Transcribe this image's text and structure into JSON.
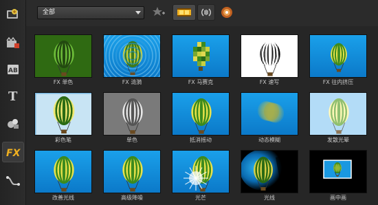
{
  "toolbar": {
    "category_dropdown": {
      "selected": "全部"
    },
    "icons": [
      "add-to-favorites-icon",
      "video-filter-icon",
      "audio-filter-icon",
      "browse-icon"
    ]
  },
  "sidebar": {
    "items": [
      {
        "name": "media-icon"
      },
      {
        "name": "instant-project-icon"
      },
      {
        "name": "transition-icon"
      },
      {
        "name": "title-icon"
      },
      {
        "name": "graphic-icon"
      },
      {
        "name": "filter-icon",
        "active": true
      },
      {
        "name": "path-icon"
      }
    ]
  },
  "filters": [
    {
      "label": "FX 单色",
      "style": "green"
    },
    {
      "label": "FX 涟漪",
      "style": "ripple"
    },
    {
      "label": "FX 马赛克",
      "style": "mosaic"
    },
    {
      "label": "FX 速写",
      "style": "sketch"
    },
    {
      "label": "FX 往内挤压",
      "style": "pinch"
    },
    {
      "label": "彩色笔",
      "style": "pen"
    },
    {
      "label": "单色",
      "style": "mono"
    },
    {
      "label": "抵消摇动",
      "style": "normal"
    },
    {
      "label": "动态模糊",
      "style": "blur"
    },
    {
      "label": "发散光晕",
      "style": "glow"
    },
    {
      "label": "改善光线",
      "style": "normal"
    },
    {
      "label": "高级降噪",
      "style": "normal"
    },
    {
      "label": "光芒",
      "style": "rays"
    },
    {
      "label": "光线",
      "style": "spotlight"
    },
    {
      "label": "画中画",
      "style": "pip"
    }
  ],
  "colors": {
    "sky": "#1e9be0",
    "balloon_green": "#3c8a1e",
    "balloon_yellow": "#e9e24a",
    "accent_active": "#f0a020"
  }
}
